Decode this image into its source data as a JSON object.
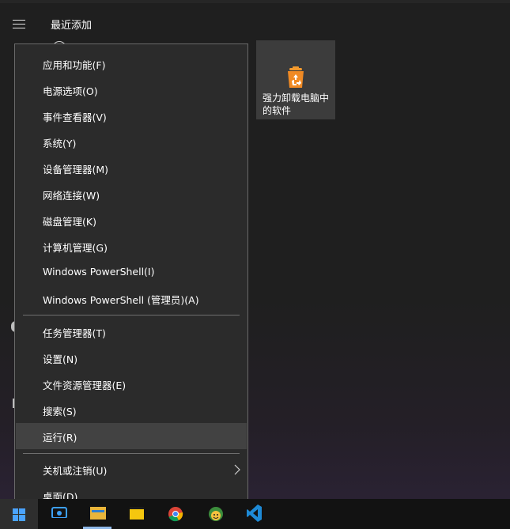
{
  "start": {
    "recent_title": "最近添加",
    "tile_label": "强力卸载电脑中的软件"
  },
  "menu": {
    "group1": [
      {
        "label": "应用和功能(F)"
      },
      {
        "label": "电源选项(O)"
      },
      {
        "label": "事件查看器(V)"
      },
      {
        "label": "系统(Y)"
      },
      {
        "label": "设备管理器(M)"
      },
      {
        "label": "网络连接(W)"
      },
      {
        "label": "磁盘管理(K)"
      },
      {
        "label": "计算机管理(G)"
      },
      {
        "label": "Windows PowerShell(I)"
      },
      {
        "label": "Windows PowerShell (管理员)(A)"
      }
    ],
    "group2": [
      {
        "label": "任务管理器(T)"
      },
      {
        "label": "设置(N)"
      },
      {
        "label": "文件资源管理器(E)"
      },
      {
        "label": "搜索(S)"
      },
      {
        "label": "运行(R)"
      }
    ],
    "group3": [
      {
        "label": "关机或注销(U)"
      },
      {
        "label": "桌面(D)"
      }
    ]
  },
  "icons": {
    "menu": "hamburger-icon",
    "tile": "recycle-bin-icon",
    "submenu": "chevron-right-icon",
    "start": "windows-logo-icon",
    "taskbar": [
      "store-icon",
      "file-explorer-icon",
      "sticky-notes-icon",
      "chrome-icon",
      "emoji-app-icon",
      "vscode-icon"
    ]
  },
  "colors": {
    "menu_bg": "#2b2b2b",
    "menu_highlight": "#424242",
    "tile_bg": "#3c3c3c",
    "windows_blue": "#0078d7",
    "vscode_blue": "#1e8ad6",
    "tile_orange": "#f08a24"
  }
}
